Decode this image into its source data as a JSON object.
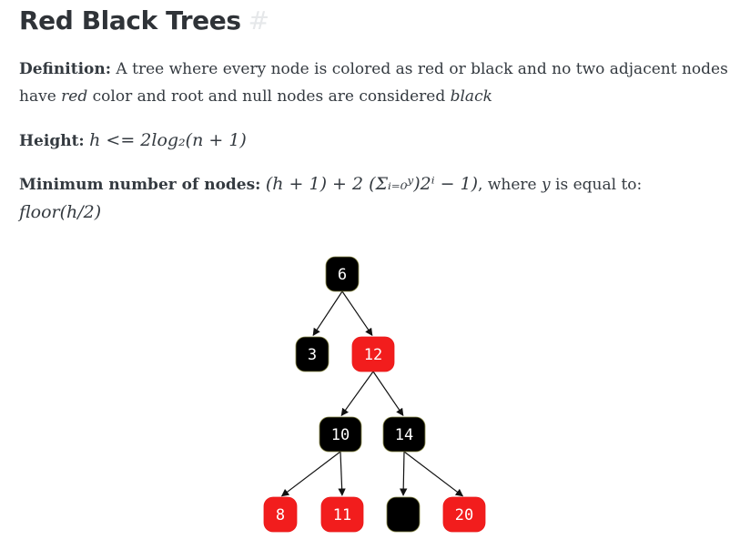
{
  "heading": {
    "title": "Red Black Trees",
    "anchor": "#"
  },
  "definition": {
    "label": "Definition:",
    "part1": " A tree where every node is colored as red or black and no two adjacent nodes",
    "part2": "have ",
    "em1": "red",
    "part3": " color and root and null nodes are considered ",
    "em2": "black"
  },
  "height": {
    "label": "Height:",
    "formula": "h <= 2log₂(n + 1)"
  },
  "min_nodes": {
    "label": "Minimum number of nodes:",
    "formula": "(h + 1) + 2 (Σᵢ₌₀ʸ)2ⁱ − 1)",
    "where_text": ", where ",
    "var": "y",
    "is_equal": " is equal to:",
    "floor_formula": "floor(h/2)"
  },
  "tree": {
    "colors": {
      "red": "#f21d1d",
      "black": "#000000",
      "text": "#ffffff",
      "edge": "#111111"
    },
    "nodes": [
      {
        "id": "n6",
        "label": "6",
        "color": "black"
      },
      {
        "id": "n3",
        "label": "3",
        "color": "black"
      },
      {
        "id": "n12",
        "label": "12",
        "color": "red"
      },
      {
        "id": "n10",
        "label": "10",
        "color": "black"
      },
      {
        "id": "n14",
        "label": "14",
        "color": "black"
      },
      {
        "id": "n8",
        "label": "8",
        "color": "red"
      },
      {
        "id": "n11",
        "label": "11",
        "color": "red"
      },
      {
        "id": "nnull",
        "label": "",
        "color": "black"
      },
      {
        "id": "n20",
        "label": "20",
        "color": "red"
      }
    ],
    "edges": [
      [
        "n6",
        "n3"
      ],
      [
        "n6",
        "n12"
      ],
      [
        "n12",
        "n10"
      ],
      [
        "n12",
        "n14"
      ],
      [
        "n10",
        "n8"
      ],
      [
        "n10",
        "n11"
      ],
      [
        "n14",
        "nnull"
      ],
      [
        "n14",
        "n20"
      ]
    ]
  }
}
